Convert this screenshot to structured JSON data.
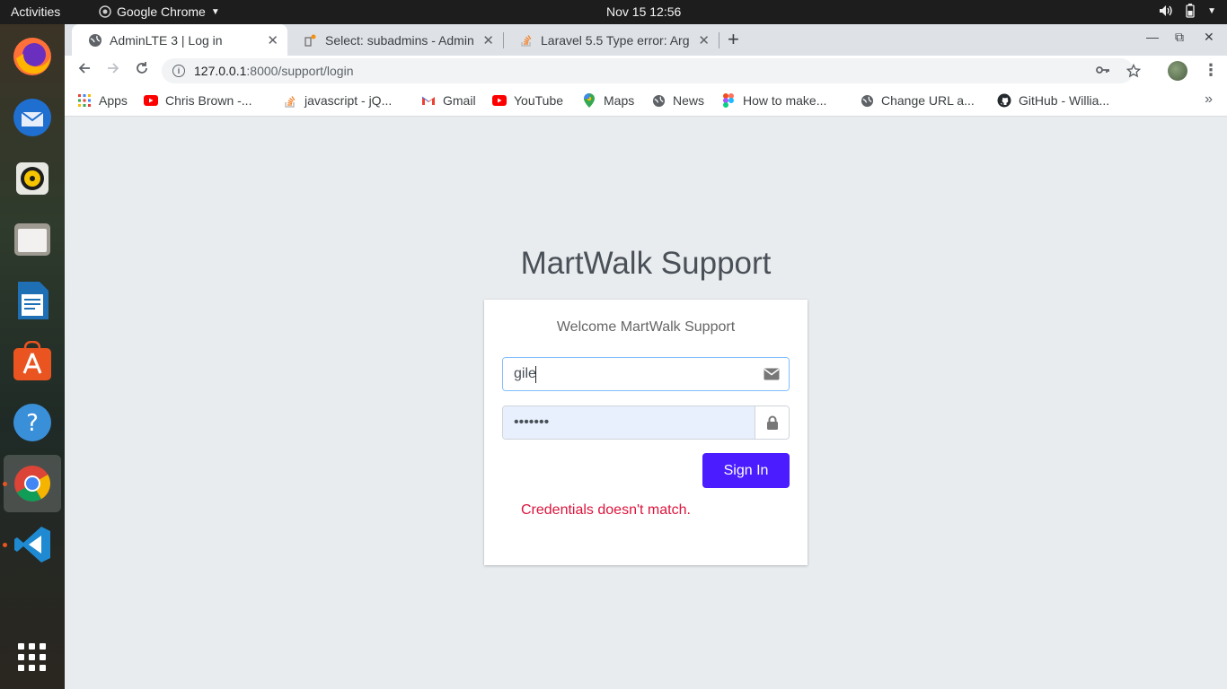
{
  "topbar": {
    "activities": "Activities",
    "app_name": "Google Chrome",
    "clock": "Nov 15  12:56"
  },
  "tabs": [
    {
      "title": "AdminLTE 3 | Log in",
      "active": true
    },
    {
      "title": "Select: subadmins - Admin",
      "active": false
    },
    {
      "title": "Laravel 5.5 Type error: Arg",
      "active": false
    }
  ],
  "address_bar": {
    "host": "127.0.0.1",
    "path": ":8000/support/login"
  },
  "bookmarks": [
    {
      "label": "Apps",
      "icon": "apps-grid-icon"
    },
    {
      "label": "Chris Brown -...",
      "icon": "youtube-icon"
    },
    {
      "label": "javascript - jQ...",
      "icon": "stackoverflow-icon"
    },
    {
      "label": "Gmail",
      "icon": "gmail-icon"
    },
    {
      "label": "YouTube",
      "icon": "youtube-icon"
    },
    {
      "label": "Maps",
      "icon": "maps-icon"
    },
    {
      "label": "News",
      "icon": "globe-icon"
    },
    {
      "label": "How to make...",
      "icon": "figma-icon"
    },
    {
      "label": "Change URL a...",
      "icon": "globe-icon"
    },
    {
      "label": "GitHub - Willia...",
      "icon": "github-icon"
    }
  ],
  "login": {
    "logo": "MartWalk Support",
    "message": "Welcome MartWalk Support",
    "email_value": "gile",
    "password_value": "•••••••",
    "signin_label": "Sign In",
    "error": "Credentials doesn't match."
  },
  "colors": {
    "accent": "#4a1cff",
    "error": "#dc143c",
    "ubuntu_orange": "#e95420"
  }
}
